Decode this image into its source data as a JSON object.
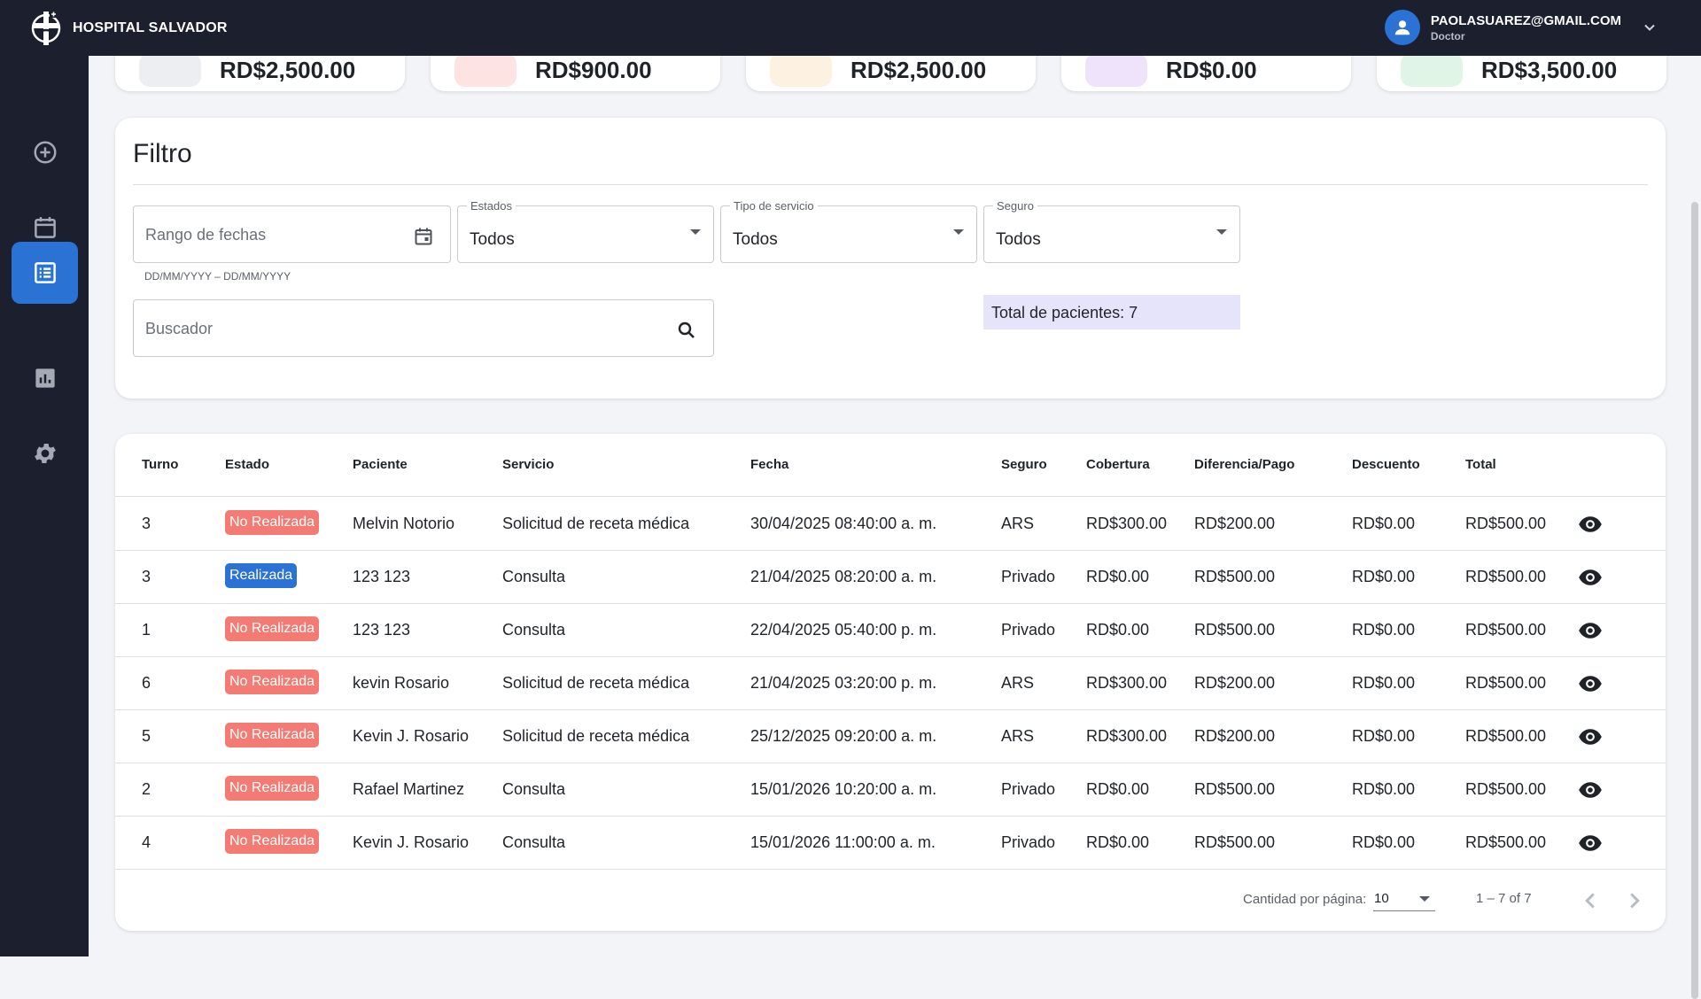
{
  "app": {
    "name": "HOSPITAL SALVADOR"
  },
  "user": {
    "email": "PAOLASUAREZ@GMAIL.COM",
    "role": "Doctor"
  },
  "nav": [
    {
      "icon": "add-circle-icon",
      "active": false
    },
    {
      "icon": "calendar-icon",
      "active": false
    },
    {
      "icon": "list-icon",
      "active": true
    },
    {
      "icon": "bar-chart-icon",
      "active": false
    },
    {
      "icon": "gear-icon",
      "active": false
    }
  ],
  "summary_cards": [
    {
      "amount": "RD$2,500.00",
      "chip_color": "#eceef1"
    },
    {
      "amount": "RD$900.00",
      "chip_color": "#fde3e1"
    },
    {
      "amount": "RD$2,500.00",
      "chip_color": "#fdf1e2"
    },
    {
      "amount": "RD$0.00",
      "chip_color": "#efe3fb"
    },
    {
      "amount": "RD$3,500.00",
      "chip_color": "#e1f5e6"
    }
  ],
  "filter": {
    "title": "Filtro",
    "date_range": {
      "placeholder": "Rango de fechas",
      "hint": "DD/MM/YYYY – DD/MM/YYYY"
    },
    "estados": {
      "label": "Estados",
      "value": "Todos"
    },
    "tipo_servicio": {
      "label": "Tipo de servicio",
      "value": "Todos"
    },
    "seguro": {
      "label": "Seguro",
      "value": "Todos"
    },
    "search": {
      "placeholder": "Buscador"
    },
    "total": "Total de pacientes: 7"
  },
  "table": {
    "headers": {
      "turno": "Turno",
      "estado": "Estado",
      "paciente": "Paciente",
      "servicio": "Servicio",
      "fecha": "Fecha",
      "seguro": "Seguro",
      "cobertura": "Cobertura",
      "diferencia": "Diferencia/Pago",
      "descuento": "Descuento",
      "total": "Total"
    },
    "rows": [
      {
        "turno": "3",
        "estado": "No Realizada",
        "paciente": "Melvin Notorio",
        "servicio": "Solicitud de receta médica",
        "fecha": "30/04/2025 08:40:00 a. m.",
        "seguro": "ARS",
        "cobertura": "RD$300.00",
        "diferencia": "RD$200.00",
        "descuento": "RD$0.00",
        "total": "RD$500.00"
      },
      {
        "turno": "3",
        "estado": "Realizada",
        "paciente": "123 123",
        "servicio": "Consulta",
        "fecha": "21/04/2025 08:20:00 a. m.",
        "seguro": "Privado",
        "cobertura": "RD$0.00",
        "diferencia": "RD$500.00",
        "descuento": "RD$0.00",
        "total": "RD$500.00"
      },
      {
        "turno": "1",
        "estado": "No Realizada",
        "paciente": "123 123",
        "servicio": "Consulta",
        "fecha": "22/04/2025 05:40:00 p. m.",
        "seguro": "Privado",
        "cobertura": "RD$0.00",
        "diferencia": "RD$500.00",
        "descuento": "RD$0.00",
        "total": "RD$500.00"
      },
      {
        "turno": "6",
        "estado": "No Realizada",
        "paciente": "kevin Rosario",
        "servicio": "Solicitud de receta médica",
        "fecha": "21/04/2025 03:20:00 p. m.",
        "seguro": "ARS",
        "cobertura": "RD$300.00",
        "diferencia": "RD$200.00",
        "descuento": "RD$0.00",
        "total": "RD$500.00"
      },
      {
        "turno": "5",
        "estado": "No Realizada",
        "paciente": "Kevin J. Rosario",
        "servicio": "Solicitud de receta médica",
        "fecha": "25/12/2025 09:20:00 a. m.",
        "seguro": "ARS",
        "cobertura": "RD$300.00",
        "diferencia": "RD$200.00",
        "descuento": "RD$0.00",
        "total": "RD$500.00"
      },
      {
        "turno": "2",
        "estado": "No Realizada",
        "paciente": "Rafael Martinez",
        "servicio": "Consulta",
        "fecha": "15/01/2026 10:20:00 a. m.",
        "seguro": "Privado",
        "cobertura": "RD$0.00",
        "diferencia": "RD$500.00",
        "descuento": "RD$0.00",
        "total": "RD$500.00"
      },
      {
        "turno": "4",
        "estado": "No Realizada",
        "paciente": "Kevin J. Rosario",
        "servicio": "Consulta",
        "fecha": "15/01/2026 11:00:00 a. m.",
        "seguro": "Privado",
        "cobertura": "RD$0.00",
        "diferencia": "RD$500.00",
        "descuento": "RD$0.00",
        "total": "RD$500.00"
      }
    ]
  },
  "pagination": {
    "label": "Cantidad por página:",
    "page_size": "10",
    "range": "1 – 7 of 7"
  },
  "colors": {
    "brand_dark": "#1c1f2e",
    "accent": "#2a72d4",
    "status_no": "#f47b73",
    "status_yes": "#2a72d4",
    "total_badge": "#e6e4fb"
  }
}
